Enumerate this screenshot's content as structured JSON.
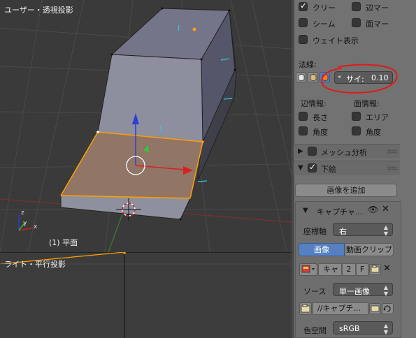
{
  "viewport_top": {
    "label": "ユーザー・透視投影",
    "object_label": "(1) 平面"
  },
  "viewport_bottom": {
    "label": "ライト・平行投影"
  },
  "panel": {
    "display": {
      "crease": "クリー",
      "edge_mark": "辺マー",
      "seam": "シーム",
      "face_mark": "面マー",
      "weight": "ウェイト表示"
    },
    "normals": {
      "title": "法線:",
      "size_label": "サイ:",
      "size_value": "0.10"
    },
    "edge_info": {
      "title": "辺情報:",
      "length": "長さ",
      "angle": "角度"
    },
    "face_info": {
      "title": "面情報:",
      "area": "エリア",
      "angle": "角度"
    },
    "mesh_analysis": "メッシュ分析",
    "background_images": {
      "title": "下絵",
      "add_button": "画像を追加",
      "item_title": "キャプチャ...",
      "axis_label": "座標軸",
      "axis_value": "右",
      "tab_image": "画像",
      "tab_movie": "動画クリップ",
      "image_name": "キャ",
      "users": "2",
      "fake": "F",
      "source_label": "ソース",
      "source_value": "単一画像",
      "filepath": "//キャプチ...",
      "colorspace_label": "色空間",
      "colorspace_value": "sRGB"
    }
  },
  "colors": {
    "annotation": "#e01a1a",
    "selection": "#ffa000",
    "active_tab": "#5680c2"
  }
}
